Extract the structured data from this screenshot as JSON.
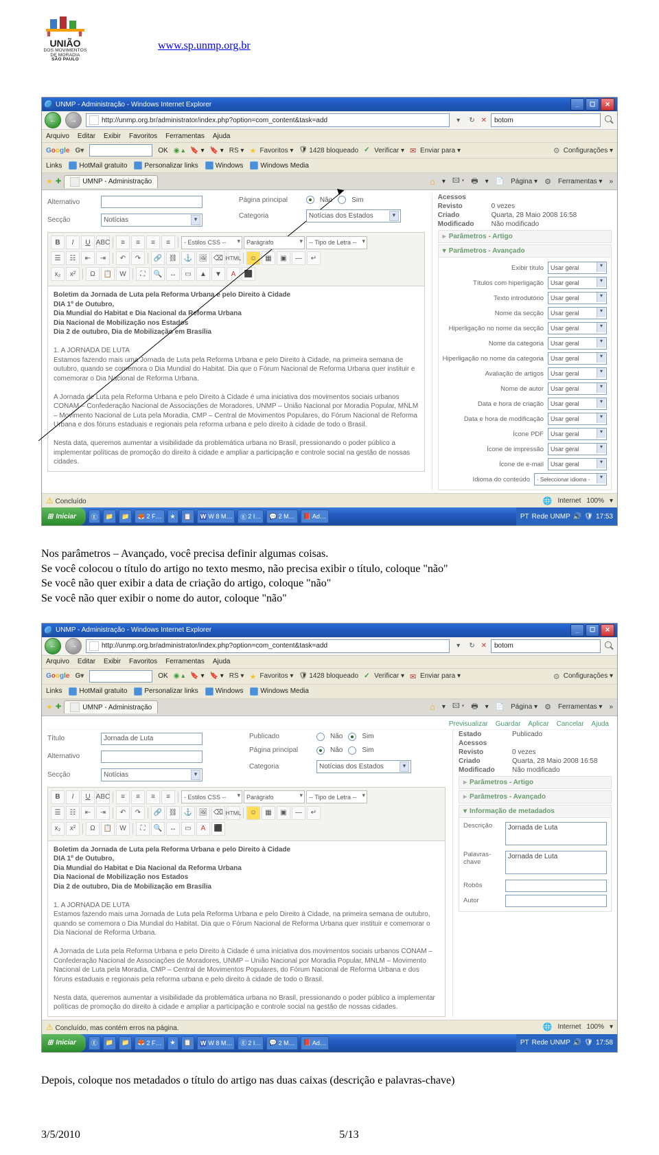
{
  "header": {
    "url": "www.sp.unmp.org.br",
    "logo": {
      "line1": "UNIÃO",
      "line2": "DOS MOVIMENTOS",
      "line3": "DE MORADIA",
      "line4": "SÃO PAULO"
    }
  },
  "ie_window": {
    "title": "UNMP - Administração - Windows Internet Explorer",
    "url": "http://unmp.org.br/administrator/index.php?option=com_content&task=add",
    "search_value": "botom",
    "menubar": [
      "Arquivo",
      "Editar",
      "Exibir",
      "Favoritos",
      "Ferramentas",
      "Ajuda"
    ],
    "google_toolbar": {
      "logo_blue": "G",
      "logo_red": "o",
      "logo_yellow": "o",
      "logo_blue2": "g",
      "logo_green": "l",
      "logo_red2": "e",
      "ok": "OK",
      "rs": "RS ▾",
      "favoritos": "Favoritos ▾",
      "bloqueado": "1428 bloqueado",
      "verificar": "Verificar ▾",
      "enviar": "Enviar para ▾",
      "config": "Configurações ▾"
    },
    "linksbar": {
      "label": "Links",
      "items": [
        "HotMail gratuito",
        "Personalizar links",
        "Windows",
        "Windows Media"
      ]
    },
    "tab_title": "UMNP - Administração",
    "tabbar_right": {
      "pagina": "Página ▾",
      "ferramentas": "Ferramentas ▾"
    },
    "status_done": "Concluído",
    "status_warn": "Concluído, mas contém erros na página.",
    "internet": "Internet",
    "zoom": "100%"
  },
  "taskbar": {
    "start": "Iniciar",
    "time": "17:53",
    "time2": "17:58",
    "lang": "PT",
    "rede": "Rede UNMP",
    "items_short": [
      "",
      "",
      "",
      "2 F…",
      "",
      "",
      "W 8 M…",
      "2 I…",
      "2 M…",
      "Ad…"
    ]
  },
  "joomla": {
    "actions": [
      "Previsualizar",
      "Guardar",
      "Aplicar",
      "Cancelar",
      "Ajuda"
    ],
    "form": {
      "titulo_label": "Título",
      "titulo_value": "Jornada de Luta",
      "alternativo_label": "Alternativo",
      "seccao_label": "Secção",
      "seccao_value": "Notícias",
      "publicado_label": "Publicado",
      "pagina_principal_label": "Página principal",
      "categoria_label": "Categoria",
      "categoria_value": "Notícias dos Estados",
      "nao": "Não",
      "sim": "Sim"
    },
    "meta": {
      "estado_label": "Estado",
      "estado_value": "Publicado",
      "acessos_label": "Acessos",
      "revisto_label": "Revisto",
      "revisto_value": "0 vezes",
      "criado_label": "Criado",
      "criado_value": "Quarta, 28 Maio 2008 16:58",
      "modificado_label": "Modificado",
      "modificado_value": "Não modificado"
    },
    "accordions": {
      "artigo": "Parâmetros - Artigo",
      "avancado": "Parâmetros - Avançado",
      "metadados": "Informação de metadados"
    },
    "params_advanced": {
      "opt": "Usar geral",
      "idioma_opt": "- Seleccionar idioma -",
      "labels": [
        "Exibir título",
        "Títulos com hiperligação",
        "Texto introdutório",
        "Nome da secção",
        "Hiperligação no nome da secção",
        "Nome da categoria",
        "Hiperligação no nome da categoria",
        "Avaliação de artigos",
        "Nome de autor",
        "Data e hora de criação",
        "Data e hora de modificação",
        "Ícone PDF",
        "Ícone de impressão",
        "Ícone de e-mail",
        "Idioma do conteúdo"
      ]
    },
    "metadata_panel": {
      "descricao_label": "Descrição",
      "palavras_label": "Palavras-chave",
      "robos_label": "Robôs",
      "autor_label": "Autor",
      "value": "Jornada de Luta"
    },
    "editor_selects": {
      "css": "- Estilos CSS --",
      "para": "Parágrafo",
      "font": "-- Tipo de Letra --"
    },
    "article": {
      "h1": "Boletim da Jornada de Luta pela Reforma Urbana e pelo Direito à Cidade",
      "l1": "DIA 1º de Outubro,",
      "l2": "Dia Mundial do Habitat e Dia Nacional da Reforma Urbana",
      "l3": "Dia Nacional de Mobilização nos Estados",
      "l4": "Dia 2 de outubro, Dia de Mobilização em Brasília",
      "p1_title": "1. A JORNADA DE LUTA",
      "p1": "Estamos fazendo mais uma Jornada de Luta pela Reforma Urbana e pelo Direito à Cidade, na primeira semana de outubro, quando se comemora o Dia Mundial do Habitat. Dia que o Fórum Nacional de Reforma Urbana quer instituir e comemorar o Dia Nacional de Reforma Urbana.",
      "p2": "A Jornada de Luta pela Reforma Urbana e pelo Direito à Cidade é uma iniciativa dos movimentos sociais urbanos CONAM – Confederação Nacional de Associações de Moradores, UNMP – União Nacional por Moradia Popular, MNLM – Movimento Nacional de Luta pela Moradia, CMP – Central de Movimentos Populares, do Fórum Nacional de Reforma Urbana e dos fóruns estaduais e regionais pela reforma urbana e pelo direito à cidade de todo o Brasil.",
      "p3": "Nesta data, queremos aumentar a visibilidade da problemática urbana no Brasil, pressionando o poder público a implementar políticas de promoção do direito à cidade e ampliar a participação e controle social na gestão de nossas cidades."
    }
  },
  "body_text": {
    "para1_l1": "Nos parâmetros – Avançado, você precisa definir algumas coisas.",
    "para1_l2": "Se você colocou o título do artigo no texto mesmo, não precisa exibir o título, coloque \"não\"",
    "para1_l3": "Se você não quer exibir a data de criação do artigo, coloque \"não\"",
    "para1_l4": "Se você não quer exibir o nome do autor, coloque \"não\"",
    "para2": "Depois, coloque nos metadados o título do artigo nas duas caixas (descrição e palavras-chave)"
  },
  "footer": {
    "date": "3/5/2010",
    "page": "5/13"
  }
}
